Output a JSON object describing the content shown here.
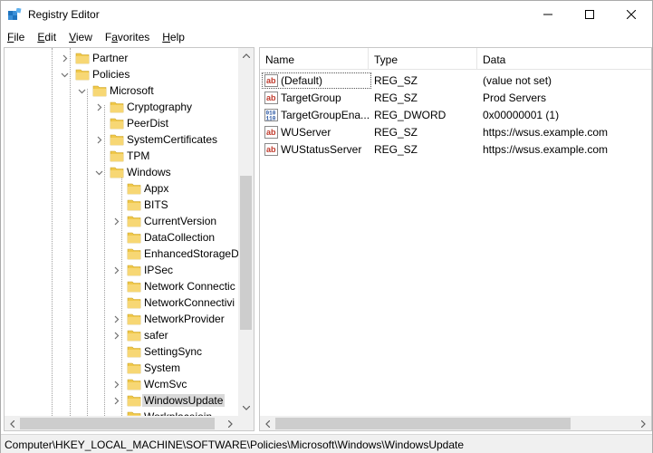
{
  "window": {
    "title": "Registry Editor"
  },
  "menu": [
    {
      "pre": "",
      "u": "F",
      "post": "ile"
    },
    {
      "pre": "",
      "u": "E",
      "post": "dit"
    },
    {
      "pre": "",
      "u": "V",
      "post": "iew"
    },
    {
      "pre": "F",
      "u": "a",
      "post": "vorites"
    },
    {
      "pre": "",
      "u": "H",
      "post": "elp"
    }
  ],
  "tree": [
    {
      "label": "Partner",
      "level": 0,
      "expander": "collapsed"
    },
    {
      "label": "Policies",
      "level": 0,
      "expander": "expanded"
    },
    {
      "label": "Microsoft",
      "level": 1,
      "expander": "expanded"
    },
    {
      "label": "Cryptography",
      "level": 2,
      "expander": "collapsed"
    },
    {
      "label": "PeerDist",
      "level": 2,
      "expander": "none"
    },
    {
      "label": "SystemCertificates",
      "level": 2,
      "expander": "collapsed"
    },
    {
      "label": "TPM",
      "level": 2,
      "expander": "none"
    },
    {
      "label": "Windows",
      "level": 2,
      "expander": "expanded"
    },
    {
      "label": "Appx",
      "level": 3,
      "expander": "none"
    },
    {
      "label": "BITS",
      "level": 3,
      "expander": "none"
    },
    {
      "label": "CurrentVersion",
      "level": 3,
      "expander": "collapsed"
    },
    {
      "label": "DataCollection",
      "level": 3,
      "expander": "none"
    },
    {
      "label": "EnhancedStorageD",
      "level": 3,
      "expander": "none"
    },
    {
      "label": "IPSec",
      "level": 3,
      "expander": "collapsed"
    },
    {
      "label": "Network Connectic",
      "level": 3,
      "expander": "none"
    },
    {
      "label": "NetworkConnectivi",
      "level": 3,
      "expander": "none"
    },
    {
      "label": "NetworkProvider",
      "level": 3,
      "expander": "collapsed"
    },
    {
      "label": "safer",
      "level": 3,
      "expander": "collapsed"
    },
    {
      "label": "SettingSync",
      "level": 3,
      "expander": "none"
    },
    {
      "label": "System",
      "level": 3,
      "expander": "none"
    },
    {
      "label": "WcmSvc",
      "level": 3,
      "expander": "collapsed"
    },
    {
      "label": "WindowsUpdate",
      "level": 3,
      "expander": "collapsed",
      "selected": true
    },
    {
      "label": "Workplacejoin",
      "level": 3,
      "expander": "none"
    }
  ],
  "list": {
    "columns": [
      "Name",
      "Type",
      "Data"
    ],
    "rows": [
      {
        "name": "(Default)",
        "type": "REG_SZ",
        "data": "(value not set)",
        "icon": "string-value-icon"
      },
      {
        "name": "TargetGroup",
        "type": "REG_SZ",
        "data": "Prod Servers",
        "icon": "string-value-icon"
      },
      {
        "name": "TargetGroupEna...",
        "type": "REG_DWORD",
        "data": "0x00000001 (1)",
        "icon": "binary-value-icon"
      },
      {
        "name": "WUServer",
        "type": "REG_SZ",
        "data": "https://wsus.example.com",
        "icon": "string-value-icon"
      },
      {
        "name": "WUStatusServer",
        "type": "REG_SZ",
        "data": "https://wsus.example.com",
        "icon": "string-value-icon"
      }
    ]
  },
  "status": {
    "path": "Computer\\HKEY_LOCAL_MACHINE\\SOFTWARE\\Policies\\Microsoft\\Windows\\WindowsUpdate"
  },
  "colors": {
    "folder": "#f0c84a",
    "selection": "#d9d9d9",
    "ab_icon": "#c0392b"
  }
}
